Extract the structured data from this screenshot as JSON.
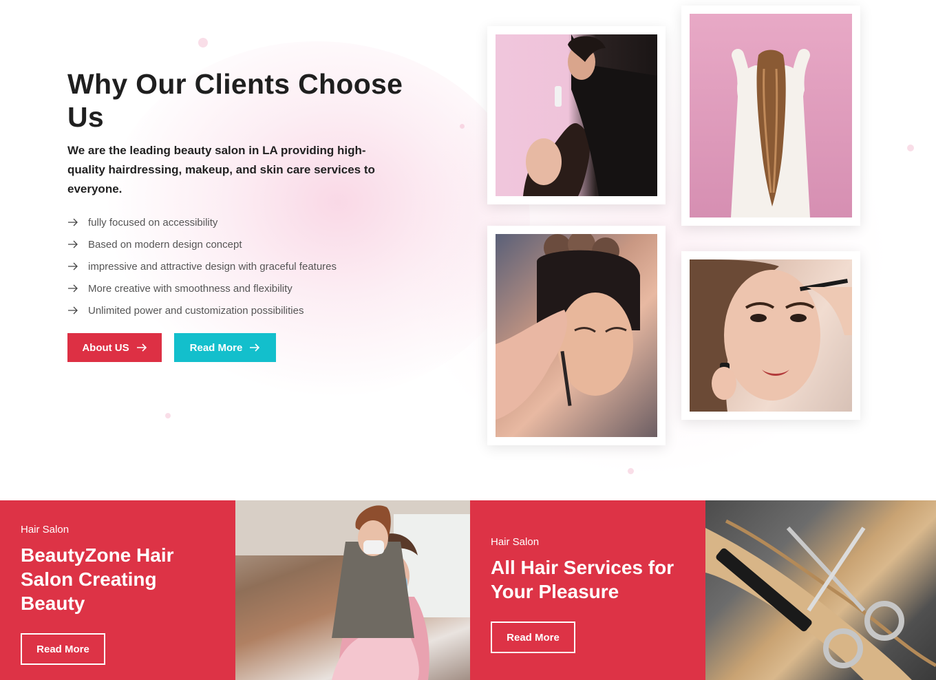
{
  "why": {
    "title": "Why Our Clients Choose Us",
    "lead": "We are the leading beauty salon in LA providing high-quality hairdressing, makeup, and skin care services to everyone.",
    "features": [
      "fully focused on accessibility",
      "Based on modern design concept",
      "impressive and attractive design with graceful features",
      "More creative with smoothness and flexibility",
      "Unlimited power and customization possibilities"
    ],
    "about_label": "About US",
    "read_label": "Read More",
    "colors": {
      "accent_red": "#dd3044",
      "accent_cyan": "#13bfcc"
    }
  },
  "photos": [
    {
      "icon": "hairdresser-photo"
    },
    {
      "icon": "long-hair-photo"
    },
    {
      "icon": "makeup-artist-photo"
    },
    {
      "icon": "eyeliner-photo"
    }
  ],
  "tiles": [
    {
      "kicker": "Hair Salon",
      "title": "BeautyZone Hair Salon Creating Beauty",
      "button": "Read More"
    },
    {
      "kicker": "Hair Salon",
      "title": "All Hair Services for Your Pleasure",
      "button": "Read More"
    }
  ]
}
